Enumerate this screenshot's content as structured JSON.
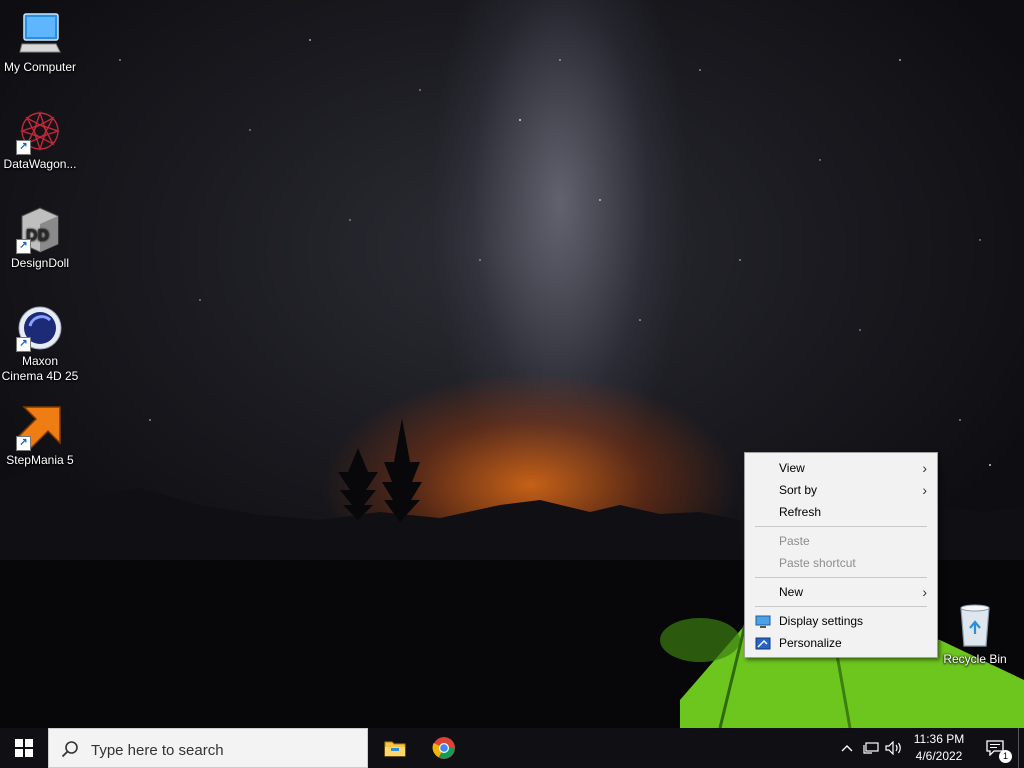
{
  "desktop": {
    "icons": [
      {
        "label": "My Computer",
        "icon": "monitor-icon",
        "shortcut": false
      },
      {
        "label": "DataWagon...",
        "icon": "datawagon-icon",
        "shortcut": true
      },
      {
        "label": "DesignDoll",
        "icon": "designdoll-icon",
        "shortcut": true
      },
      {
        "label": "Maxon Cinema 4D 25",
        "icon": "cinema4d-icon",
        "shortcut": true
      },
      {
        "label": "StepMania 5",
        "icon": "stepmania-icon",
        "shortcut": true
      },
      {
        "label": "Recycle Bin",
        "icon": "recycle-bin-icon",
        "shortcut": false
      }
    ]
  },
  "context_menu": {
    "items": {
      "view": "View",
      "sort_by": "Sort by",
      "refresh": "Refresh",
      "paste": "Paste",
      "paste_shortcut": "Paste shortcut",
      "new": "New",
      "display_settings": "Display settings",
      "personalize": "Personalize"
    },
    "submenu_arrow": "›"
  },
  "taskbar": {
    "search_placeholder": "Type here to search",
    "pinned": [
      "file-explorer-icon",
      "chrome-icon"
    ],
    "clock": {
      "time": "11:36 PM",
      "date": "4/6/2022"
    },
    "notification_count": "1"
  },
  "colors": {
    "taskbar_bg": "#101014",
    "menu_bg": "#f2f2f2",
    "accent": "#0078d7"
  }
}
